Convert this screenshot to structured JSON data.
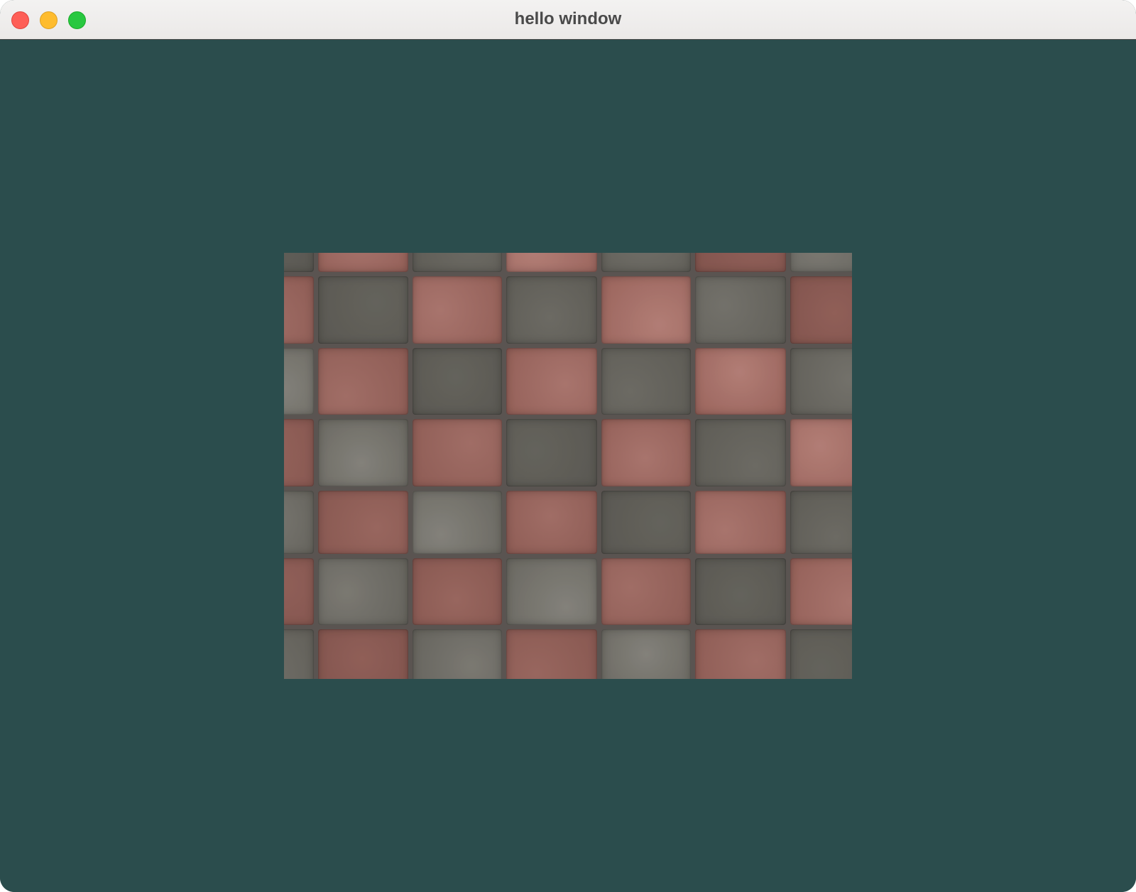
{
  "window": {
    "title": "hello window",
    "background_color": "#2b4d4d"
  },
  "traffic_lights": {
    "close": {
      "icon": "close-dot-icon",
      "color": "#fe5f57"
    },
    "minimize": {
      "icon": "minimize-dot-icon",
      "color": "#febc2e"
    },
    "zoom": {
      "icon": "zoom-dot-icon",
      "color": "#28c840"
    }
  },
  "render": {
    "texture": "brick-checkerboard-tiles",
    "tile_colors": {
      "red": "#9a645c",
      "gray": "#6a6861"
    }
  }
}
